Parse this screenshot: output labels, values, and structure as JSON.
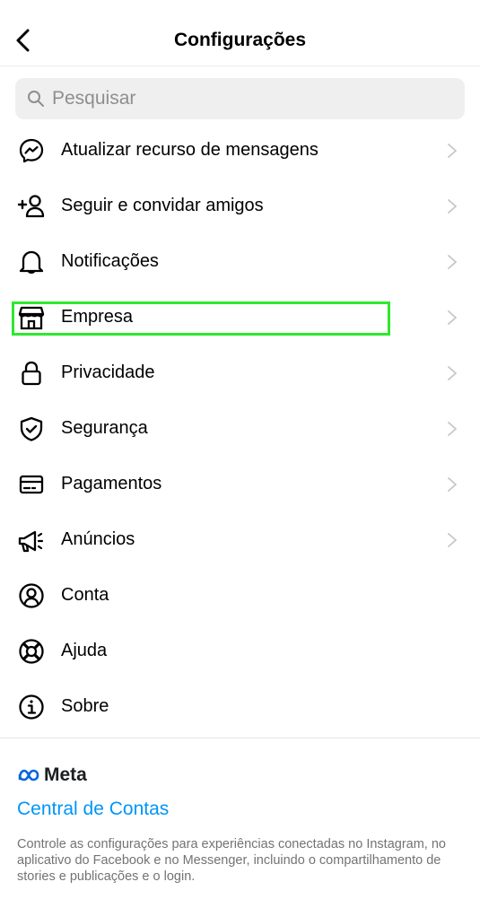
{
  "header": {
    "title": "Configurações"
  },
  "search": {
    "placeholder": "Pesquisar"
  },
  "menu": [
    {
      "label": "Atualizar recurso de mensagens",
      "icon": "messenger-icon",
      "chevron": true
    },
    {
      "label": "Seguir e convidar amigos",
      "icon": "add-person-icon",
      "chevron": true
    },
    {
      "label": "Notificações",
      "icon": "bell-icon",
      "chevron": true
    },
    {
      "label": "Empresa",
      "icon": "shop-icon",
      "chevron": true
    },
    {
      "label": "Privacidade",
      "icon": "lock-icon",
      "chevron": true
    },
    {
      "label": "Segurança",
      "icon": "shield-icon",
      "chevron": true
    },
    {
      "label": "Pagamentos",
      "icon": "card-icon",
      "chevron": true
    },
    {
      "label": "Anúncios",
      "icon": "megaphone-icon",
      "chevron": true
    },
    {
      "label": "Conta",
      "icon": "account-icon",
      "chevron": false
    },
    {
      "label": "Ajuda",
      "icon": "lifebuoy-icon",
      "chevron": false
    },
    {
      "label": "Sobre",
      "icon": "info-icon",
      "chevron": false
    }
  ],
  "meta": {
    "brand": "Meta",
    "accounts_center": "Central de Contas",
    "description": "Controle as configurações para experiências conectadas no Instagram, no aplicativo do Facebook e no Messenger, incluindo o compartilhamento de stories e publicações e o login."
  },
  "colors": {
    "link": "#0095f6",
    "highlight": "#2ee82e",
    "muted": "#737373"
  }
}
